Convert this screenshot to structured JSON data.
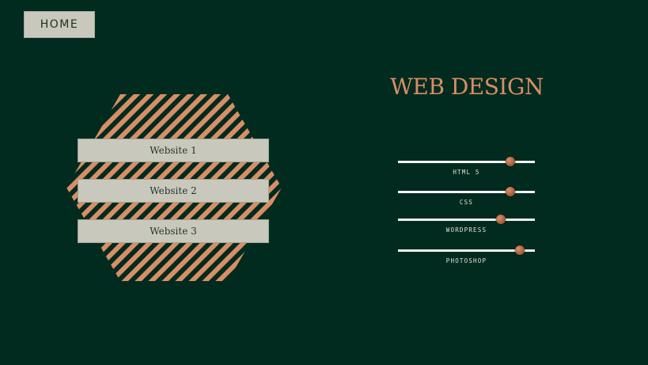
{
  "nav": {
    "home_label": "HOME"
  },
  "projects": {
    "items": [
      {
        "label": "Website 1"
      },
      {
        "label": "Website 2"
      },
      {
        "label": "Website 3"
      }
    ]
  },
  "skills": {
    "title": "WEB DESIGN",
    "items": [
      {
        "label": "HTML 5",
        "level": 0.82
      },
      {
        "label": "CSS",
        "level": 0.82
      },
      {
        "label": "WORDPRESS",
        "level": 0.75
      },
      {
        "label": "PHOTOSHOP",
        "level": 0.89
      }
    ]
  },
  "colors": {
    "background": "#022b1f",
    "accent": "#d88e66",
    "button_fill": "#c8c9bc",
    "track": "#f4f4f0"
  }
}
